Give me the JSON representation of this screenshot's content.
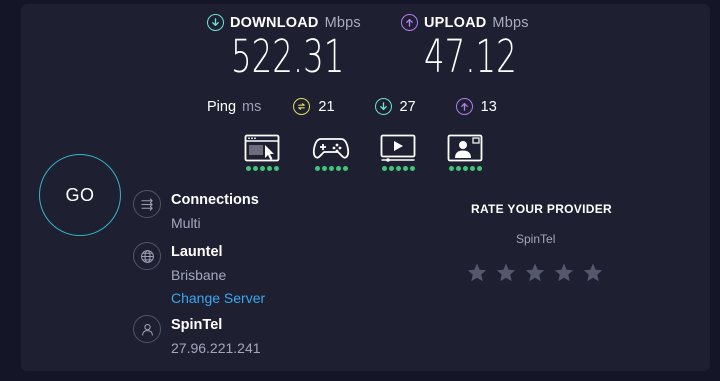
{
  "download": {
    "label": "DOWNLOAD",
    "unit": "Mbps",
    "value": "522.31",
    "icon": "arrow-down-circle-icon"
  },
  "upload": {
    "label": "UPLOAD",
    "unit": "Mbps",
    "value": "47.12",
    "icon": "arrow-up-circle-icon"
  },
  "ping": {
    "label": "Ping",
    "unit": "ms",
    "idle": "21",
    "download": "27",
    "upload": "13"
  },
  "activities": [
    {
      "name": "web-browsing",
      "icon": "browser-cursor-icon",
      "rating_dots": 5
    },
    {
      "name": "gaming",
      "icon": "gamepad-icon",
      "rating_dots": 5
    },
    {
      "name": "streaming",
      "icon": "video-play-icon",
      "rating_dots": 5
    },
    {
      "name": "video-chat",
      "icon": "video-call-icon",
      "rating_dots": 5
    }
  ],
  "go_button": {
    "label": "GO"
  },
  "connections": {
    "title": "Connections",
    "value": "Multi",
    "icon": "connections-icon"
  },
  "server": {
    "title": "Launtel",
    "location": "Brisbane",
    "change_link": "Change Server",
    "icon": "globe-icon"
  },
  "provider": {
    "title": "SpinTel",
    "ip": "27.96.221.241",
    "icon": "user-icon"
  },
  "rating": {
    "title": "RATE YOUR PROVIDER",
    "provider": "SpinTel",
    "stars": 5,
    "filled": 0
  },
  "colors": {
    "background": "#141526",
    "panel": "#1e2032",
    "download_accent": "#6be3d4",
    "upload_accent": "#b47cf0",
    "ping_accent": "#e8db5f",
    "go_ring": "#2fb7c9",
    "link": "#3aa7f0",
    "rating_dot": "#3ec67a",
    "star_empty": "#55586d"
  }
}
